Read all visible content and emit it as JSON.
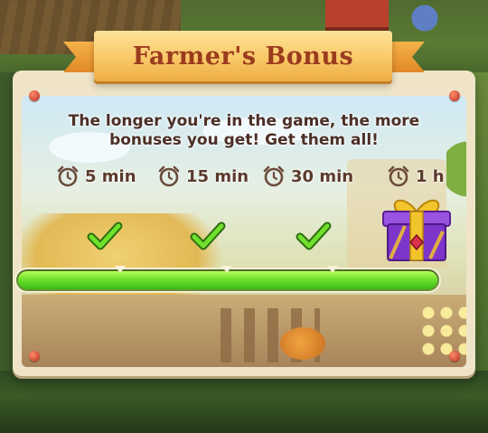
{
  "popup": {
    "title": "Farmer's Bonus",
    "description": "The longer you're in the game, the more bonuses you get! Get them all!"
  },
  "milestones": [
    {
      "label": "5 min",
      "icon": "alarm-clock-icon",
      "claimed": true
    },
    {
      "label": "15 min",
      "icon": "alarm-clock-icon",
      "claimed": true
    },
    {
      "label": "30 min",
      "icon": "alarm-clock-icon",
      "claimed": true
    },
    {
      "label": "1 h",
      "icon": "alarm-clock-icon",
      "claimed": false,
      "reward": "gift-box-icon"
    }
  ],
  "progress": {
    "fraction": 1.0
  },
  "colors": {
    "title": "#9b3b1e",
    "ribbon": "#f9c867",
    "progress_fill": "#6fe02b",
    "check": "#5fd41a",
    "gift_box": "#7d36c9",
    "gift_ribbon": "#f2c42c",
    "text": "#4b2f26"
  }
}
